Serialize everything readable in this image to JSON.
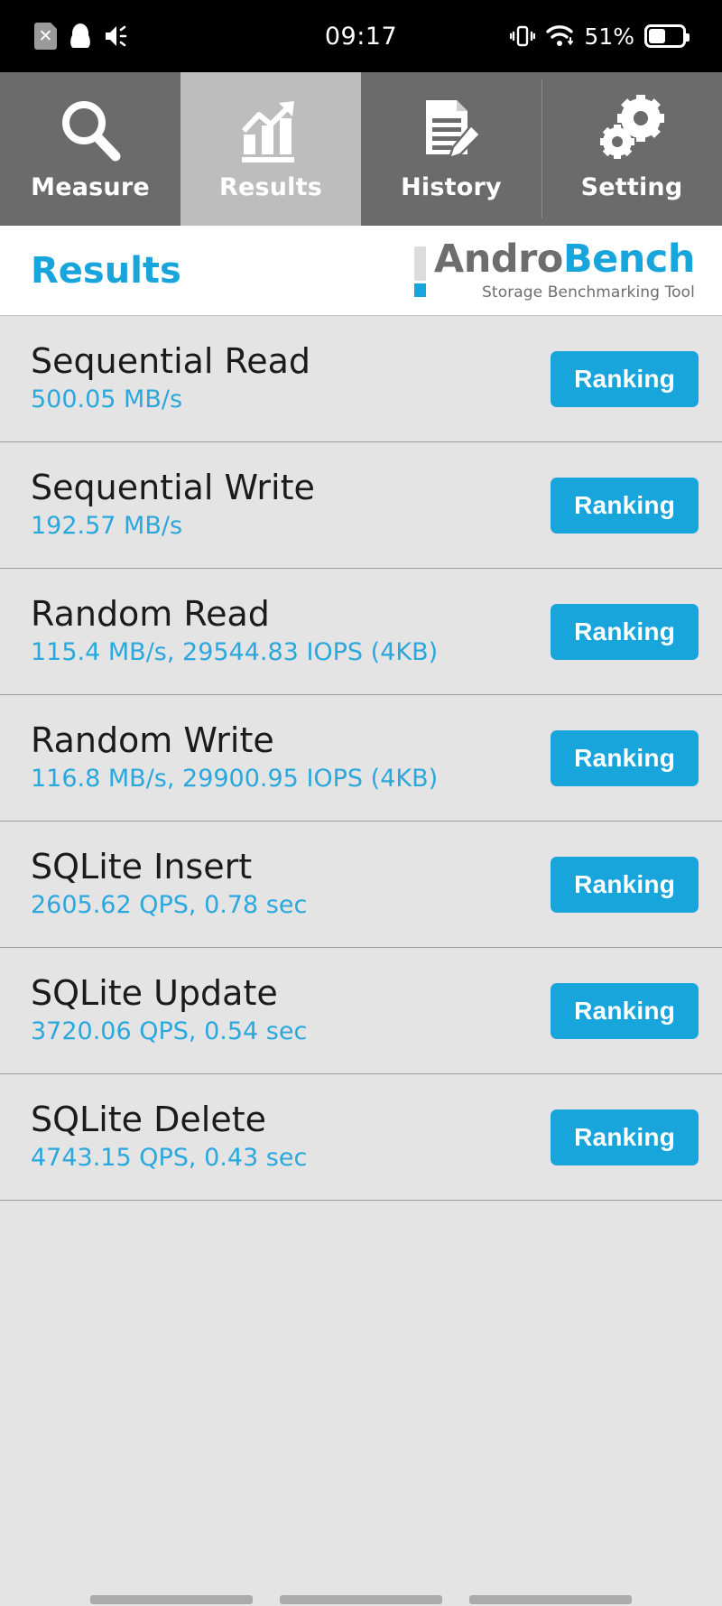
{
  "statusbar": {
    "clock": "09:17",
    "battery_percent": "51%",
    "left_icons": [
      "sdcard-disabled-icon",
      "qq-penguin-icon",
      "volume-icon"
    ],
    "right_icons": [
      "vibrate-icon",
      "wifi-icon",
      "battery-icon"
    ]
  },
  "tabs": [
    {
      "label": "Measure",
      "icon": "magnifier-icon",
      "active": false
    },
    {
      "label": "Results",
      "icon": "bar-chart-arrow-icon",
      "active": true
    },
    {
      "label": "History",
      "icon": "document-pencil-icon",
      "active": false
    },
    {
      "label": "Setting",
      "icon": "gears-icon",
      "active": false
    }
  ],
  "header": {
    "title": "Results",
    "logo_part1": "Andro",
    "logo_part2": "Bench",
    "logo_tagline": "Storage Benchmarking Tool"
  },
  "colors": {
    "accent_blue": "#18a5dc",
    "value_blue": "#2aa8dd",
    "tab_bg": "#6b6b6b",
    "tab_active_bg": "#bdbdbd",
    "list_bg": "#e4e4e4"
  },
  "results": {
    "button_label": "Ranking",
    "rows": [
      {
        "title": "Sequential Read",
        "value": "500.05 MB/s"
      },
      {
        "title": "Sequential Write",
        "value": "192.57 MB/s"
      },
      {
        "title": "Random Read",
        "value": "115.4 MB/s, 29544.83 IOPS (4KB)"
      },
      {
        "title": "Random Write",
        "value": "116.8 MB/s, 29900.95 IOPS (4KB)"
      },
      {
        "title": "SQLite Insert",
        "value": "2605.62 QPS, 0.78 sec"
      },
      {
        "title": "SQLite Update",
        "value": "3720.06 QPS, 0.54 sec"
      },
      {
        "title": "SQLite Delete",
        "value": "4743.15 QPS, 0.43 sec"
      }
    ]
  },
  "navbar": {
    "items": [
      "recents-button",
      "home-button",
      "back-button"
    ]
  }
}
